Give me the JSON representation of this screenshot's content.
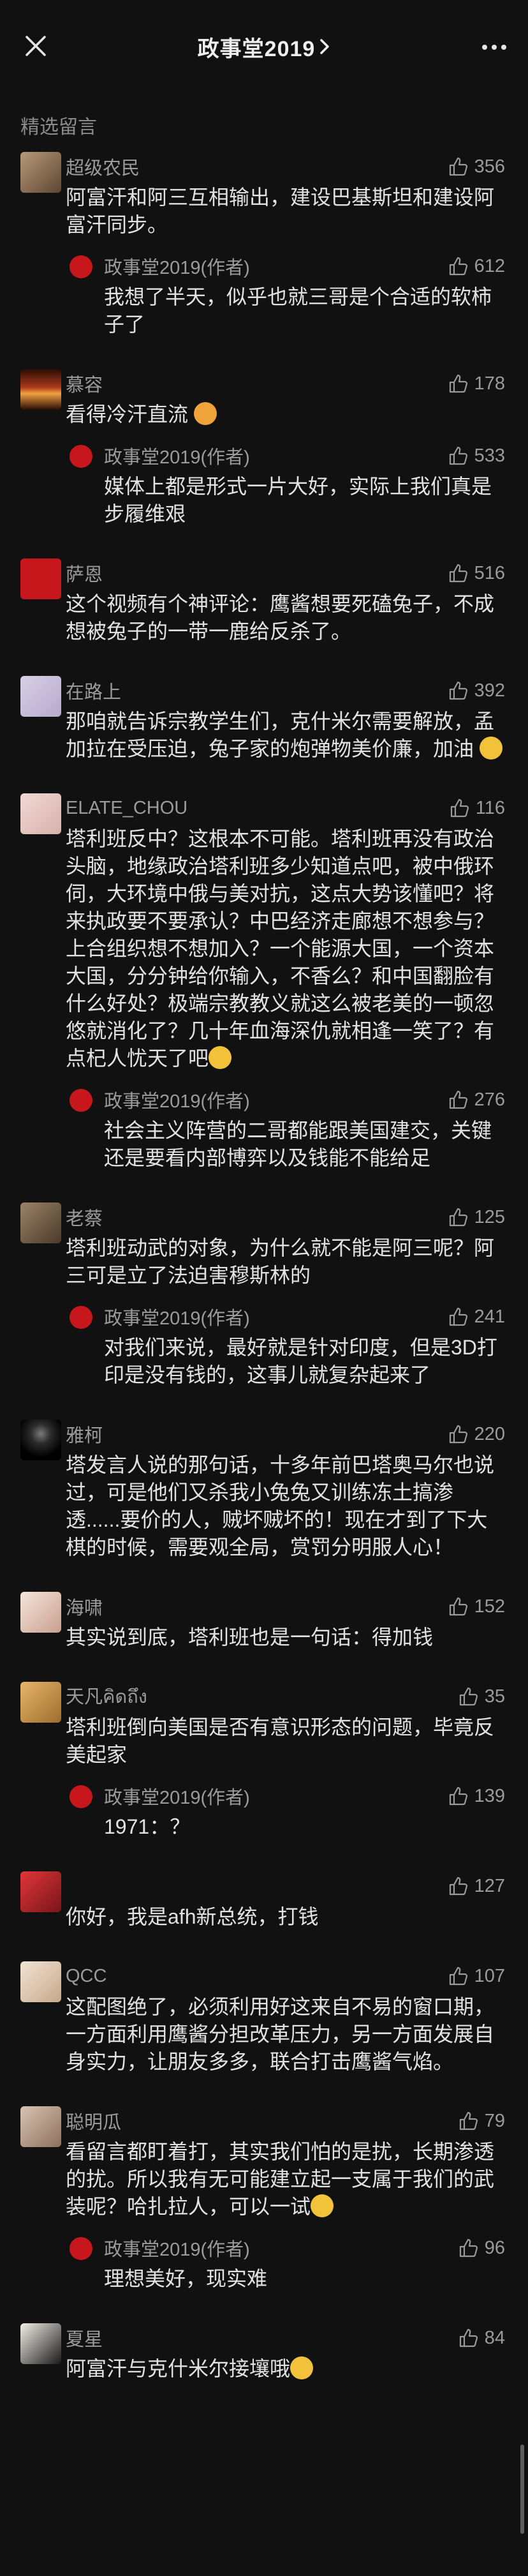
{
  "header": {
    "title": "政事堂2019",
    "chevron": "chevron-right-icon",
    "close": "close-icon",
    "more": "more-icon"
  },
  "section_label": "精选留言",
  "colors": {
    "background": "#111111",
    "author_badge": "#c8161d"
  },
  "comments": [
    {
      "name": "超级农民",
      "likes": "356",
      "text": "阿富汗和阿三互相输出，建设巴基斯坦和建设阿富汗同步。",
      "reply": {
        "name": "政事堂2019(作者)",
        "likes": "612",
        "text": "我想了半天，似乎也就三哥是个合适的软柿子了"
      }
    },
    {
      "name": "慕容",
      "likes": "178",
      "text": "看得冷汗直流",
      "reply": {
        "name": "政事堂2019(作者)",
        "likes": "533",
        "text": "媒体上都是形式一片大好，实际上我们真是步履维艰"
      }
    },
    {
      "name": "萨恩",
      "likes": "516",
      "text": "这个视频有个神评论：鹰酱想要死磕兔子，不成想被兔子的一带一鹿给反杀了。"
    },
    {
      "name": "在路上",
      "likes": "392",
      "text": "那咱就告诉宗教学生们，克什米尔需要解放，孟加拉在受压迫，兔子家的炮弹物美价廉，加油"
    },
    {
      "name": "ELATE_CHOU",
      "likes": "116",
      "text": "塔利班反中？这根本不可能。塔利班再没有政治头脑，地缘政治塔利班多少知道点吧，被中俄环伺，大环境中俄与美对抗，这点大势该懂吧？将来执政要不要承认？中巴经济走廊想不想参与？上合组织想不想加入？一个能源大国，一个资本大国，分分钟给你输入，不香么？和中国翻脸有什么好处？极端宗教教义就这么被老美的一顿忽悠就消化了？几十年血海深仇就相逢一笑了？有点杞人忧天了吧",
      "reply": {
        "name": "政事堂2019(作者)",
        "likes": "276",
        "text": "社会主义阵营的二哥都能跟美国建交，关键还是要看内部博弈以及钱能不能给足"
      }
    },
    {
      "name": "老蔡",
      "likes": "125",
      "text": "塔利班动武的对象，为什么就不能是阿三呢？阿三可是立了法迫害穆斯林的",
      "reply": {
        "name": "政事堂2019(作者)",
        "likes": "241",
        "text": "对我们来说，最好就是针对印度，但是3D打印是没有钱的，这事儿就复杂起来了"
      }
    },
    {
      "name": "雅柯",
      "likes": "220",
      "text": "塔发言人说的那句话，十多年前巴塔奥马尔也说过，可是他们又杀我小兔兔又训练冻土搞渗透......要价的人，贼坏贼坏的！现在才到了下大棋的时候，需要观全局，赏罚分明服人心！"
    },
    {
      "name": "海啸",
      "likes": "152",
      "text": "其实说到底，塔利班也是一句话：得加钱"
    },
    {
      "name": "天凡คิดถึง",
      "likes": "35",
      "text": "塔利班倒向美国是否有意识形态的问题，毕竟反美起家",
      "reply": {
        "name": "政事堂2019(作者)",
        "likes": "139",
        "text": "1971：？"
      }
    },
    {
      "name": "",
      "likes": "127",
      "text": "你好，我是afh新总统，打钱"
    },
    {
      "name": "QCC",
      "likes": "107",
      "text": "这配图绝了，必须利用好这来自不易的窗口期，一方面利用鹰酱分担改革压力，另一方面发展自身实力，让朋友多多，联合打击鹰酱气焰。"
    },
    {
      "name": "聪明瓜",
      "likes": "79",
      "text": "看留言都盯着打，其实我们怕的是扰，长期渗透的扰。所以我有无可能建立起一支属于我们的武装呢？哈扎拉人，可以一试",
      "reply": {
        "name": "政事堂2019(作者)",
        "likes": "96",
        "text": "理想美好，现实难"
      }
    },
    {
      "name": "夏星",
      "likes": "84",
      "text": "阿富汗与克什米尔接壤哦"
    }
  ]
}
